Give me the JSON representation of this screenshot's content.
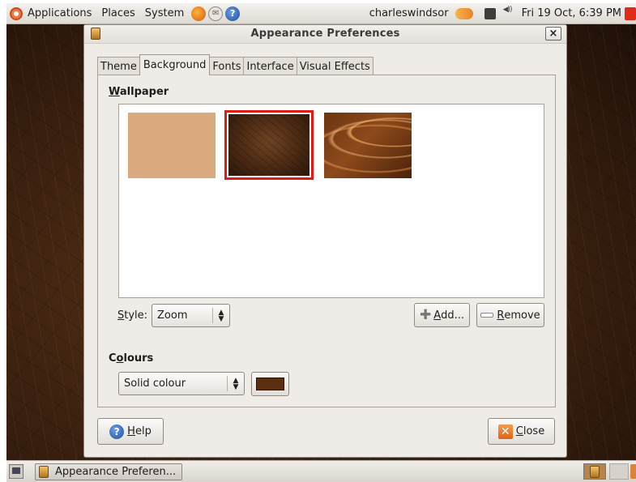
{
  "top_panel": {
    "menus": [
      "Applications",
      "Places",
      "System"
    ],
    "user": "charleswindsor",
    "clock": "Fri 19 Oct,  6:39 PM"
  },
  "window": {
    "title": "Appearance Preferences",
    "close_glyph": "×",
    "tabs": [
      {
        "label": "Theme",
        "active": false
      },
      {
        "label": "Background",
        "active": true
      },
      {
        "label": "Fonts",
        "active": false
      },
      {
        "label": "Interface",
        "active": false
      },
      {
        "label": "Visual Effects",
        "active": false
      }
    ]
  },
  "background_tab": {
    "wallpaper_heading": "Wallpaper",
    "wallpapers": [
      {
        "name": "plain-beige",
        "color": "#d9aa7e",
        "selected": false
      },
      {
        "name": "dark-brown-grunge",
        "color": "#4a2913",
        "selected": true
      },
      {
        "name": "brown-swirl",
        "color": "#7a3e14",
        "selected": false
      }
    ],
    "selection_color": "#e11b12",
    "style_label": "Style:",
    "style_value": "Zoom",
    "add_label": "Add...",
    "remove_label": "Remove",
    "colours_heading": "Colours",
    "colour_mode_value": "Solid colour",
    "colour_swatch": "#5b2e10"
  },
  "footer": {
    "help_label": "Help",
    "close_label": "Close"
  },
  "bottom_panel": {
    "task_label": "Appearance Preferen..."
  }
}
